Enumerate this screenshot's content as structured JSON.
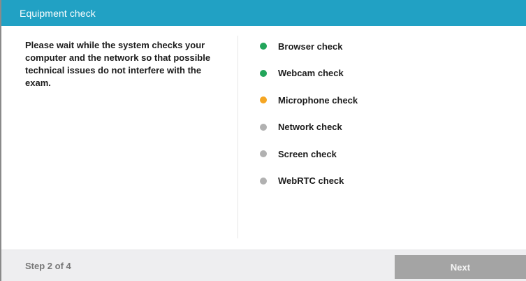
{
  "header": {
    "title": "Equipment check"
  },
  "instructions": "Please wait while the system checks your computer and the network so that possible technical issues do not interfere with the exam.",
  "checks": [
    {
      "label": "Browser check",
      "status": "passed",
      "color": "#22a55a"
    },
    {
      "label": "Webcam check",
      "status": "passed",
      "color": "#22a55a"
    },
    {
      "label": "Microphone check",
      "status": "in-progress",
      "color": "#f5a623"
    },
    {
      "label": "Network check",
      "status": "pending",
      "color": "#b1b1b1"
    },
    {
      "label": "Screen check",
      "status": "pending",
      "color": "#b1b1b1"
    },
    {
      "label": "WebRTC check",
      "status": "pending",
      "color": "#b1b1b1"
    }
  ],
  "footer": {
    "step": "Step 2 of 4",
    "next_label": "Next",
    "next_enabled": false
  }
}
